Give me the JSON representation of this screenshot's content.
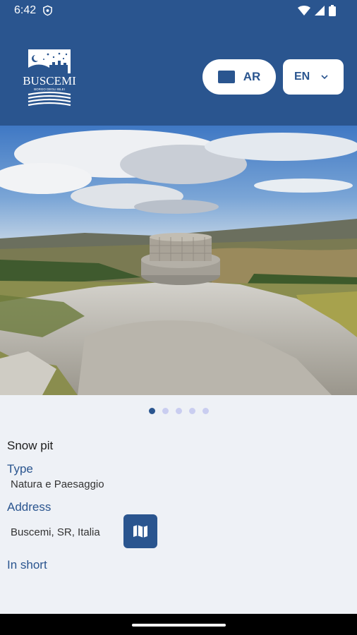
{
  "status_bar": {
    "time": "6:42"
  },
  "header": {
    "logo_text": "BUSCEMI",
    "logo_subtitle": "BORGO DEGLI IBLEI",
    "ar_label": "AR",
    "language_selected": "EN"
  },
  "carousel": {
    "total_slides": 5,
    "active_index": 0
  },
  "detail": {
    "title": "Snow pit",
    "type_label": "Type",
    "type_value": "Natura e Paesaggio",
    "address_label": "Address",
    "address_value": "Buscemi, SR, Italia",
    "in_short_label": "In short"
  },
  "colors": {
    "primary": "#2a558f",
    "background": "#eef1f6",
    "dot_inactive": "#c9cdf0"
  }
}
